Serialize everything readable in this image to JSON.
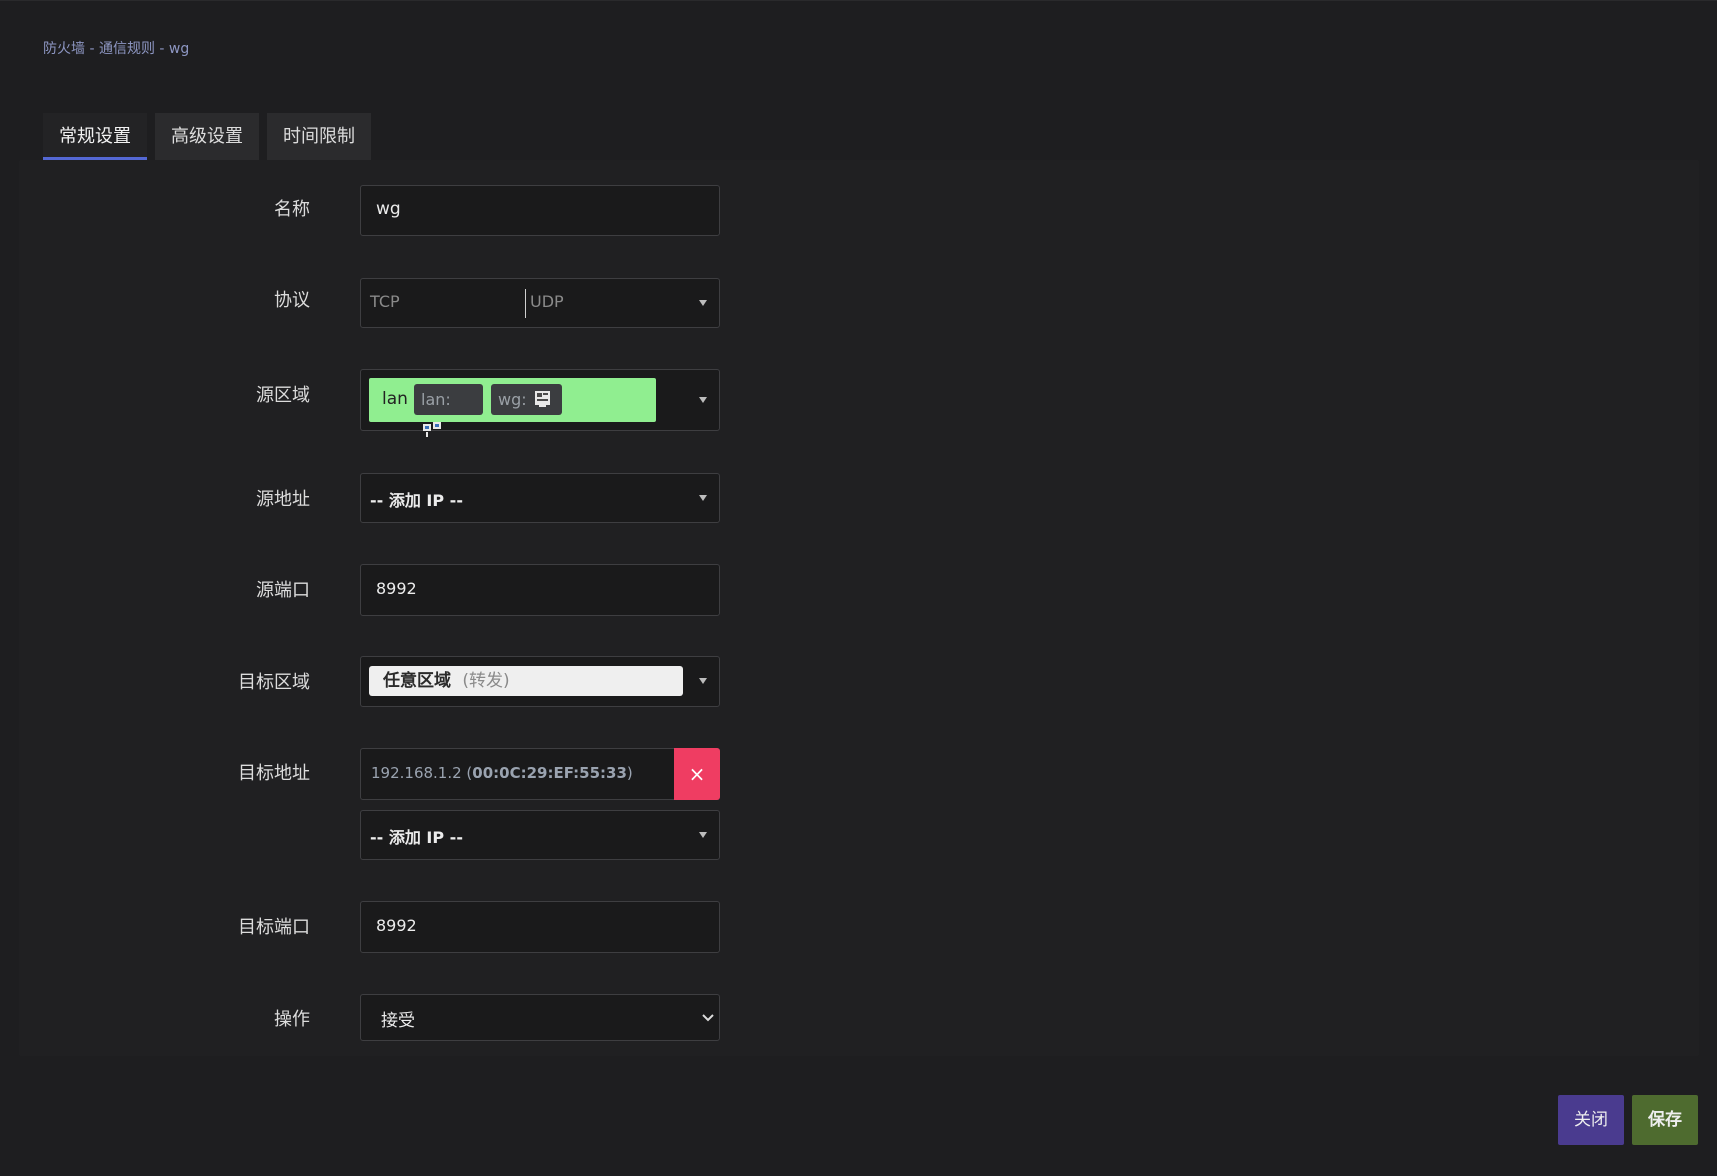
{
  "breadcrumb": "防火墙 - 通信规则 - wg",
  "tabs": [
    {
      "label": "常规设置",
      "active": true
    },
    {
      "label": "高级设置",
      "active": false
    },
    {
      "label": "时间限制",
      "active": false
    }
  ],
  "fields": {
    "name": {
      "label": "名称",
      "value": "wg"
    },
    "protocol": {
      "label": "协议",
      "values": [
        "TCP",
        "UDP"
      ]
    },
    "src_zone": {
      "label": "源区域",
      "zone": "lan",
      "tags": [
        "lan:",
        "wg:"
      ],
      "color": "#90ee90"
    },
    "src_addr": {
      "label": "源地址",
      "placeholder": "-- 添加 IP --"
    },
    "src_port": {
      "label": "源端口",
      "value": "8992"
    },
    "dest_zone": {
      "label": "目标区域",
      "zone": "任意区域",
      "note": "(转发)"
    },
    "dest_addr": {
      "label": "目标地址",
      "entry_ip": "192.168.1.2",
      "entry_mac": "00:0C:29:EF:55:33",
      "remove": "×",
      "placeholder": "-- 添加 IP --"
    },
    "dest_port": {
      "label": "目标端口",
      "value": "8992"
    },
    "action": {
      "label": "操作",
      "value": "接受"
    }
  },
  "buttons": {
    "close": "关闭",
    "save": "保存"
  },
  "colors": {
    "tab_active": "#5468d4",
    "remove_button": "#ef3d62",
    "close_button": "#4a3b8f",
    "save_button": "#4e6b2f"
  }
}
